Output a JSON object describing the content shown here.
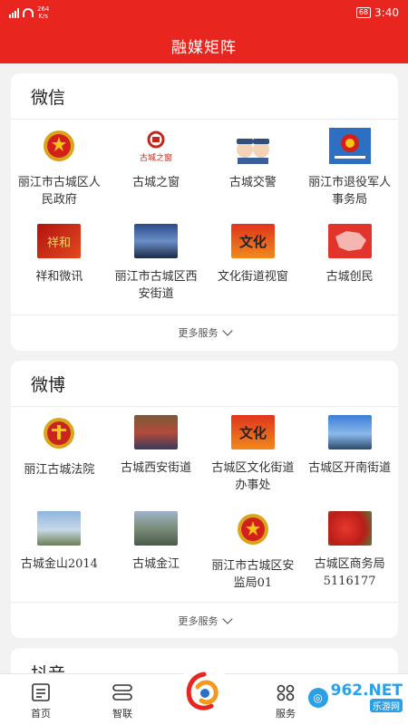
{
  "status_bar": {
    "net_speed": "264\nK/s",
    "battery": "68",
    "time": "3:40"
  },
  "header": {
    "title": "融媒矩阵"
  },
  "wechat": {
    "title": "微信",
    "items": [
      {
        "label": "丽江市古城区人民政府",
        "icon": "national-emblem-icon"
      },
      {
        "label": "古城之窗",
        "icon": "gucheng-window-logo"
      },
      {
        "label": "古城交警",
        "icon": "traffic-police-icon"
      },
      {
        "label": "丽江市退役军人事务局",
        "icon": "veterans-bureau-logo"
      },
      {
        "label": "祥和微讯",
        "icon": "xianghe-logo"
      },
      {
        "label": "丽江市古城区西安街道",
        "icon": "xian-street-photo"
      },
      {
        "label": "文化街道视窗",
        "icon": "culture-street-logo"
      },
      {
        "label": "古城创民",
        "icon": "chuangmin-map-logo"
      }
    ],
    "more": "更多服务"
  },
  "weibo": {
    "title": "微博",
    "items": [
      {
        "label": "丽江古城法院",
        "icon": "court-emblem-icon"
      },
      {
        "label": "古城西安街道",
        "icon": "xian-street-photo"
      },
      {
        "label": "古城区文化街道办事处",
        "icon": "culture-street-logo"
      },
      {
        "label": "古城区开南街道",
        "icon": "kainan-street-photo"
      },
      {
        "label": "古城金山2014",
        "icon": "jinshan-photo"
      },
      {
        "label": "古城金江",
        "icon": "jinjiang-photo"
      },
      {
        "label": "丽江市古城区安监局01",
        "icon": "safety-bureau-emblem"
      },
      {
        "label": "古城区商务局5116177",
        "icon": "commerce-bureau-photo"
      }
    ],
    "more": "更多服务"
  },
  "douyin": {
    "title": "抖音"
  },
  "tabbar": {
    "tabs": [
      {
        "label": "首页",
        "icon": "home-icon"
      },
      {
        "label": "智联",
        "icon": "connect-icon"
      },
      {
        "label": "",
        "icon": "app-logo-icon"
      },
      {
        "label": "服务",
        "icon": "service-icon"
      }
    ]
  },
  "watermark": {
    "text": "962.NET",
    "sub": "乐游网"
  },
  "colors": {
    "brand_red": "#e8251e",
    "card_bg": "#ffffff",
    "page_bg": "#f2f2f2",
    "watermark_blue": "#2aa0e8"
  }
}
